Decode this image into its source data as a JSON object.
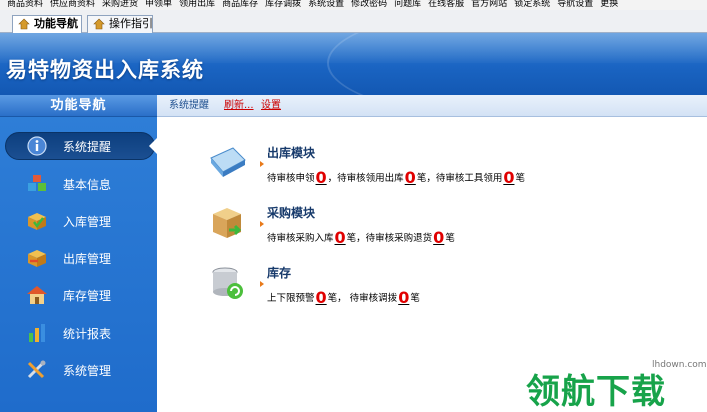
{
  "menu": [
    "商品资料",
    "供应商资料",
    "采购进货",
    "申领单",
    "领用出库",
    "商品库存",
    "库存调拨",
    "系统设置",
    "修改密码",
    "问题库",
    "在线客服",
    "官方网站",
    "锁定系统",
    "导航设置",
    "更换"
  ],
  "tabs": [
    {
      "label": "功能导航",
      "active": true
    },
    {
      "label": "操作指引",
      "active": false
    }
  ],
  "app_title": "易特物资出入库系统",
  "sidebar": {
    "title": "功能导航",
    "items": [
      {
        "label": "系统提醒",
        "icon": "info-icon",
        "active": true
      },
      {
        "label": "基本信息",
        "icon": "cubes-icon",
        "active": false
      },
      {
        "label": "入库管理",
        "icon": "box-in-icon",
        "active": false
      },
      {
        "label": "出库管理",
        "icon": "box-out-icon",
        "active": false
      },
      {
        "label": "库存管理",
        "icon": "house-icon",
        "active": false
      },
      {
        "label": "统计报表",
        "icon": "bar-chart-icon",
        "active": false
      },
      {
        "label": "系统管理",
        "icon": "tools-icon",
        "active": false
      }
    ]
  },
  "content": {
    "breadcrumb": "系统提醒",
    "refresh": "刷新...",
    "settings": "设置",
    "modules": [
      {
        "title": "出库模块",
        "icon": "book-icon",
        "segments": [
          {
            "text": "待审核申领"
          },
          {
            "num": "0"
          },
          {
            "text": "，待审核领用出库"
          },
          {
            "num": "0"
          },
          {
            "text": "笔，待审核工具领用"
          },
          {
            "num": "0"
          },
          {
            "text": "笔"
          }
        ]
      },
      {
        "title": "采购模块",
        "icon": "package-icon",
        "segments": [
          {
            "text": "待审核采购入库"
          },
          {
            "num": "0"
          },
          {
            "text": "笔，待审核采购退货"
          },
          {
            "num": "0"
          },
          {
            "text": "笔"
          }
        ]
      },
      {
        "title": "库存",
        "icon": "database-refresh-icon",
        "segments": [
          {
            "text": "上下限预警"
          },
          {
            "num": "0"
          },
          {
            "text": "笔，  待审核调拨"
          },
          {
            "num": "0"
          },
          {
            "text": "笔"
          }
        ]
      }
    ]
  },
  "watermark": {
    "url": "lhdown.com",
    "text": "领航下载"
  },
  "colors": {
    "header": "#1a64c2",
    "sidebar": "#2f7fd8",
    "number": "#e00000",
    "link": "#cc0000",
    "watermark": "#17a34a"
  }
}
